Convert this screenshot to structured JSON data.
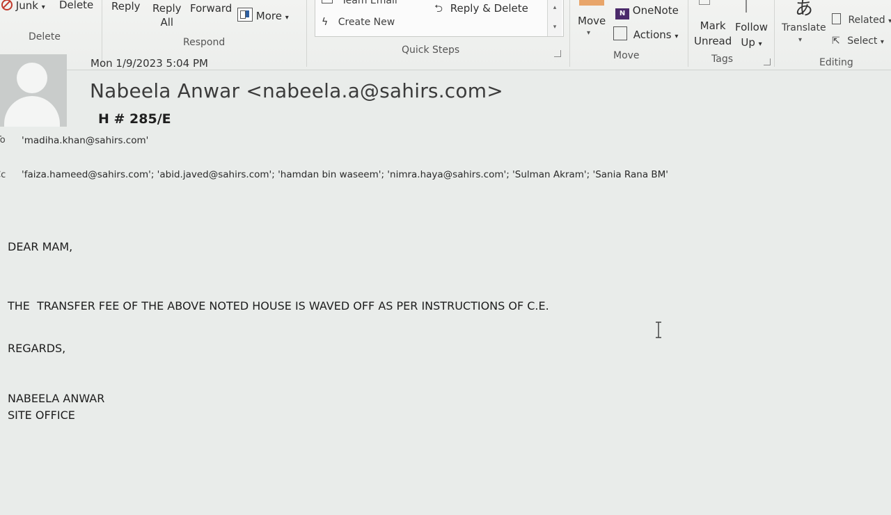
{
  "ribbon": {
    "delete_group": {
      "junk": "Junk",
      "delete": "Delete",
      "label": "Delete"
    },
    "respond_group": {
      "reply": "Reply",
      "reply_all_1": "Reply",
      "reply_all_2": "All",
      "forward": "Forward",
      "more": "More",
      "label": "Respond"
    },
    "quick_steps": {
      "team_email": "Team Email",
      "create_new": "Create New",
      "reply_delete": "Reply & Delete",
      "label": "Quick Steps"
    },
    "move_group": {
      "move": "Move",
      "onenote": "OneNote",
      "actions": "Actions",
      "label": "Move"
    },
    "tags_group": {
      "mark_1": "Mark",
      "mark_2": "Unread",
      "follow_1": "Follow",
      "follow_2": "Up",
      "label": "Tags"
    },
    "editing_group": {
      "translate": "Translate",
      "related": "Related",
      "select": "Select",
      "label": "Editing"
    }
  },
  "message": {
    "sent": "Mon 1/9/2023 5:04 PM",
    "sender": "Nabeela Anwar <nabeela.a@sahirs.com>",
    "subject": "H # 285/E",
    "to_label": "To",
    "to": "'madiha.khan@sahirs.com'",
    "cc_label": "Cc",
    "cc": "'faiza.hameed@sahirs.com'; 'abid.javed@sahirs.com'; 'hamdan bin waseem'; 'nimra.haya@sahirs.com'; 'Sulman Akram'; 'Sania Rana BM'"
  },
  "body": {
    "greeting": "DEAR MAM,",
    "line1": "THE  TRANSFER FEE OF THE ABOVE NOTED HOUSE IS WAVED OFF AS PER INSTRUCTIONS OF C.E.",
    "closing": "REGARDS,",
    "signature_name": "NABEELA ANWAR",
    "signature_title": "SITE OFFICE"
  },
  "icons": [
    "junk-icon",
    "more-icon",
    "team-email-icon",
    "create-new-icon",
    "reply-delete-icon",
    "onenote-icon",
    "actions-icon",
    "follow-up-flag-icon",
    "translate-icon",
    "related-icon",
    "select-icon",
    "avatar-icon",
    "text-cursor-icon"
  ]
}
